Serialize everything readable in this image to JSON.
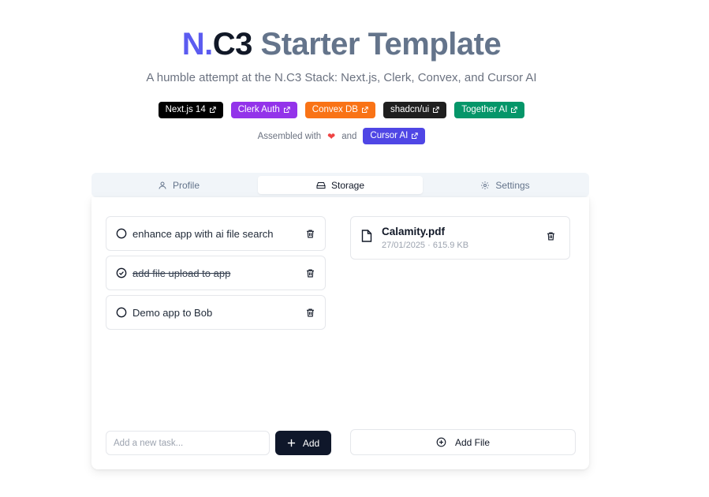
{
  "header": {
    "title_n": "N.",
    "title_c3": "C3",
    "title_rest": "Starter Template",
    "subtitle": "A humble attempt at the N.C3 Stack: Next.js, Clerk, Convex, and Cursor AI"
  },
  "badges": [
    {
      "label": "Next.js 14",
      "color": "#000000"
    },
    {
      "label": "Clerk Auth",
      "color": "#9333ea"
    },
    {
      "label": "Convex DB",
      "color": "#f97316"
    },
    {
      "label": "shadcn/ui",
      "color": "#1f1f1f"
    },
    {
      "label": "Together AI",
      "color": "#059669"
    }
  ],
  "assembled": {
    "prefix": "Assembled with",
    "heart": "❤",
    "conjunction": "and",
    "badge_label": "Cursor AI",
    "badge_color": "#4f46e5"
  },
  "tabs": [
    {
      "label": "Profile",
      "icon": "user-icon",
      "active": false
    },
    {
      "label": "Storage",
      "icon": "hard-drive-icon",
      "active": true
    },
    {
      "label": "Settings",
      "icon": "gear-icon",
      "active": false
    }
  ],
  "tasks": [
    {
      "text": "enhance app with ai file search",
      "completed": false
    },
    {
      "text": "add file upload to app",
      "completed": true
    },
    {
      "text": "Demo app to Bob",
      "completed": false
    }
  ],
  "task_input": {
    "placeholder": "Add a new task...",
    "value": ""
  },
  "add_button_label": "Add",
  "files": [
    {
      "name": "Calamity.pdf",
      "meta": "27/01/2025 · 615.9 KB"
    }
  ],
  "add_file_label": "Add File"
}
